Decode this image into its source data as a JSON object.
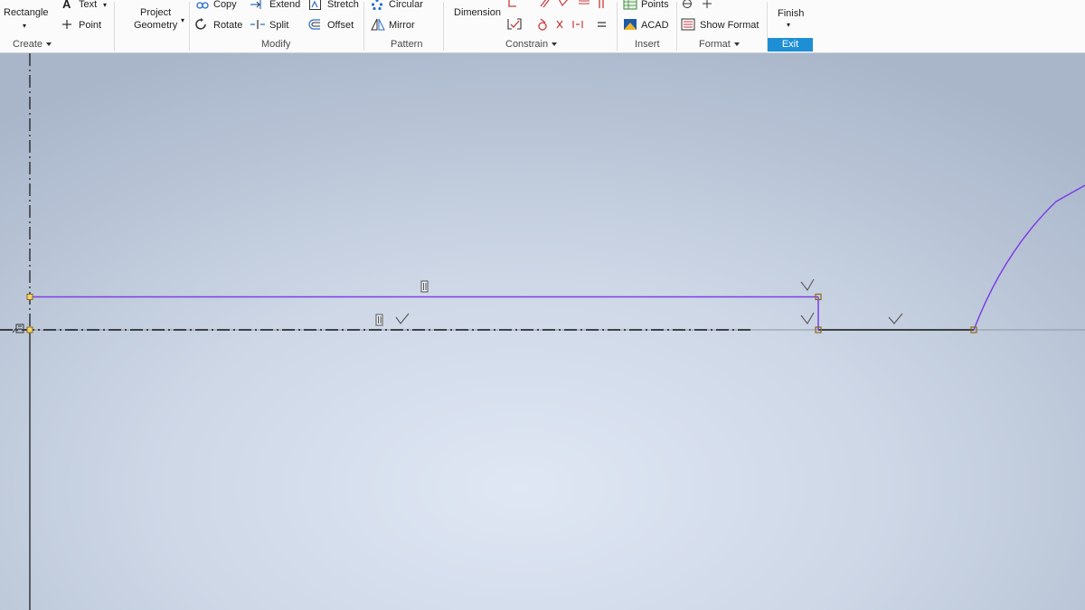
{
  "ribbon": {
    "create": {
      "rectangle": "Rectangle",
      "text": "Text",
      "point": "Point",
      "group_label": "Create"
    },
    "project_geometry": {
      "line1": "Project",
      "line2": "Geometry"
    },
    "modify": {
      "copy": "Copy",
      "extend": "Extend",
      "stretch": "Stretch",
      "rotate": "Rotate",
      "split": "Split",
      "offset": "Offset",
      "group_label": "Modify"
    },
    "pattern": {
      "circular": "Circular",
      "mirror": "Mirror",
      "group_label": "Pattern"
    },
    "constrain": {
      "dimension": "Dimension",
      "group_label": "Constrain"
    },
    "insert": {
      "points": "Points",
      "acad": "ACAD",
      "group_label": "Insert"
    },
    "format": {
      "show_format": "Show Format",
      "group_label": "Format"
    },
    "exit": {
      "finish": "Finish",
      "group_label": "Exit"
    }
  },
  "colors": {
    "sketch_line": "#7b3fe4",
    "centerline": "#111111",
    "endpoint": "#c89a2a",
    "exit_accent": "#1e8fd5"
  }
}
